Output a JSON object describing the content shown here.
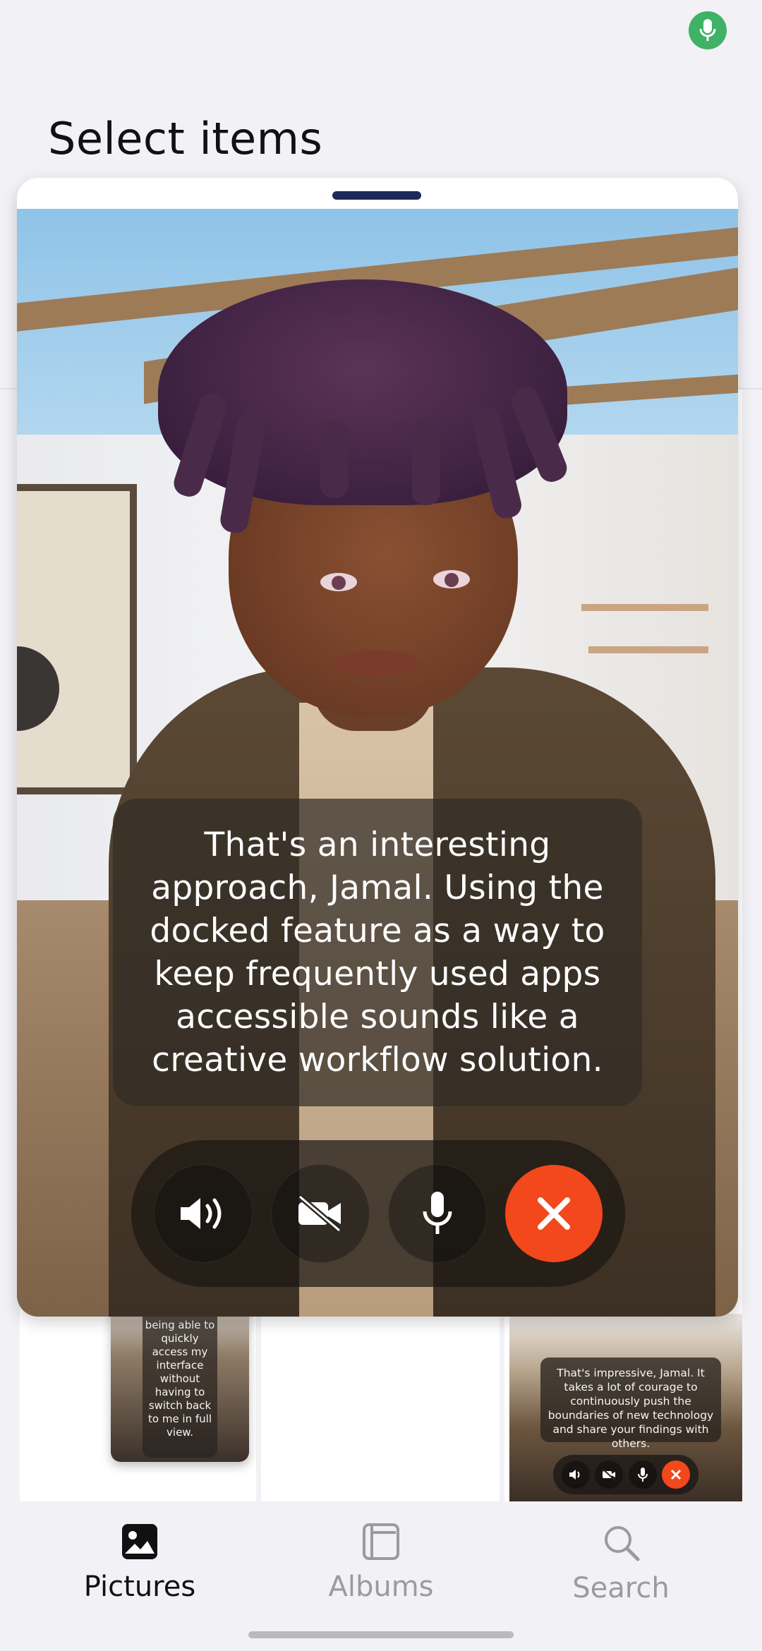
{
  "status": {
    "mic_icon": "microphone-icon",
    "mic_color": "#3fb265"
  },
  "page": {
    "title": "Select items"
  },
  "call": {
    "subtitle": "That's an interesting approach, Jamal. Using the docked feature as a way to keep frequently used apps accessible sounds like a creative workflow solution.",
    "controls": [
      {
        "icon": "speaker-icon"
      },
      {
        "icon": "video-off-icon"
      },
      {
        "icon": "microphone-icon"
      },
      {
        "icon": "close-icon",
        "color": "#f2481c"
      }
    ]
  },
  "grid": {
    "thumb_mid_caption": "would be being able to quickly access my interface without having to switch back to me in full view.",
    "thumb_right_caption": "That's impressive, Jamal. It takes a lot of courage to continuously push the boundaries of new technology and share your findings with others."
  },
  "nav": {
    "items": [
      {
        "label": "Pictures",
        "icon": "picture-icon",
        "active": true
      },
      {
        "label": "Albums",
        "icon": "album-icon",
        "active": false
      },
      {
        "label": "Search",
        "icon": "search-icon",
        "active": false
      }
    ]
  }
}
